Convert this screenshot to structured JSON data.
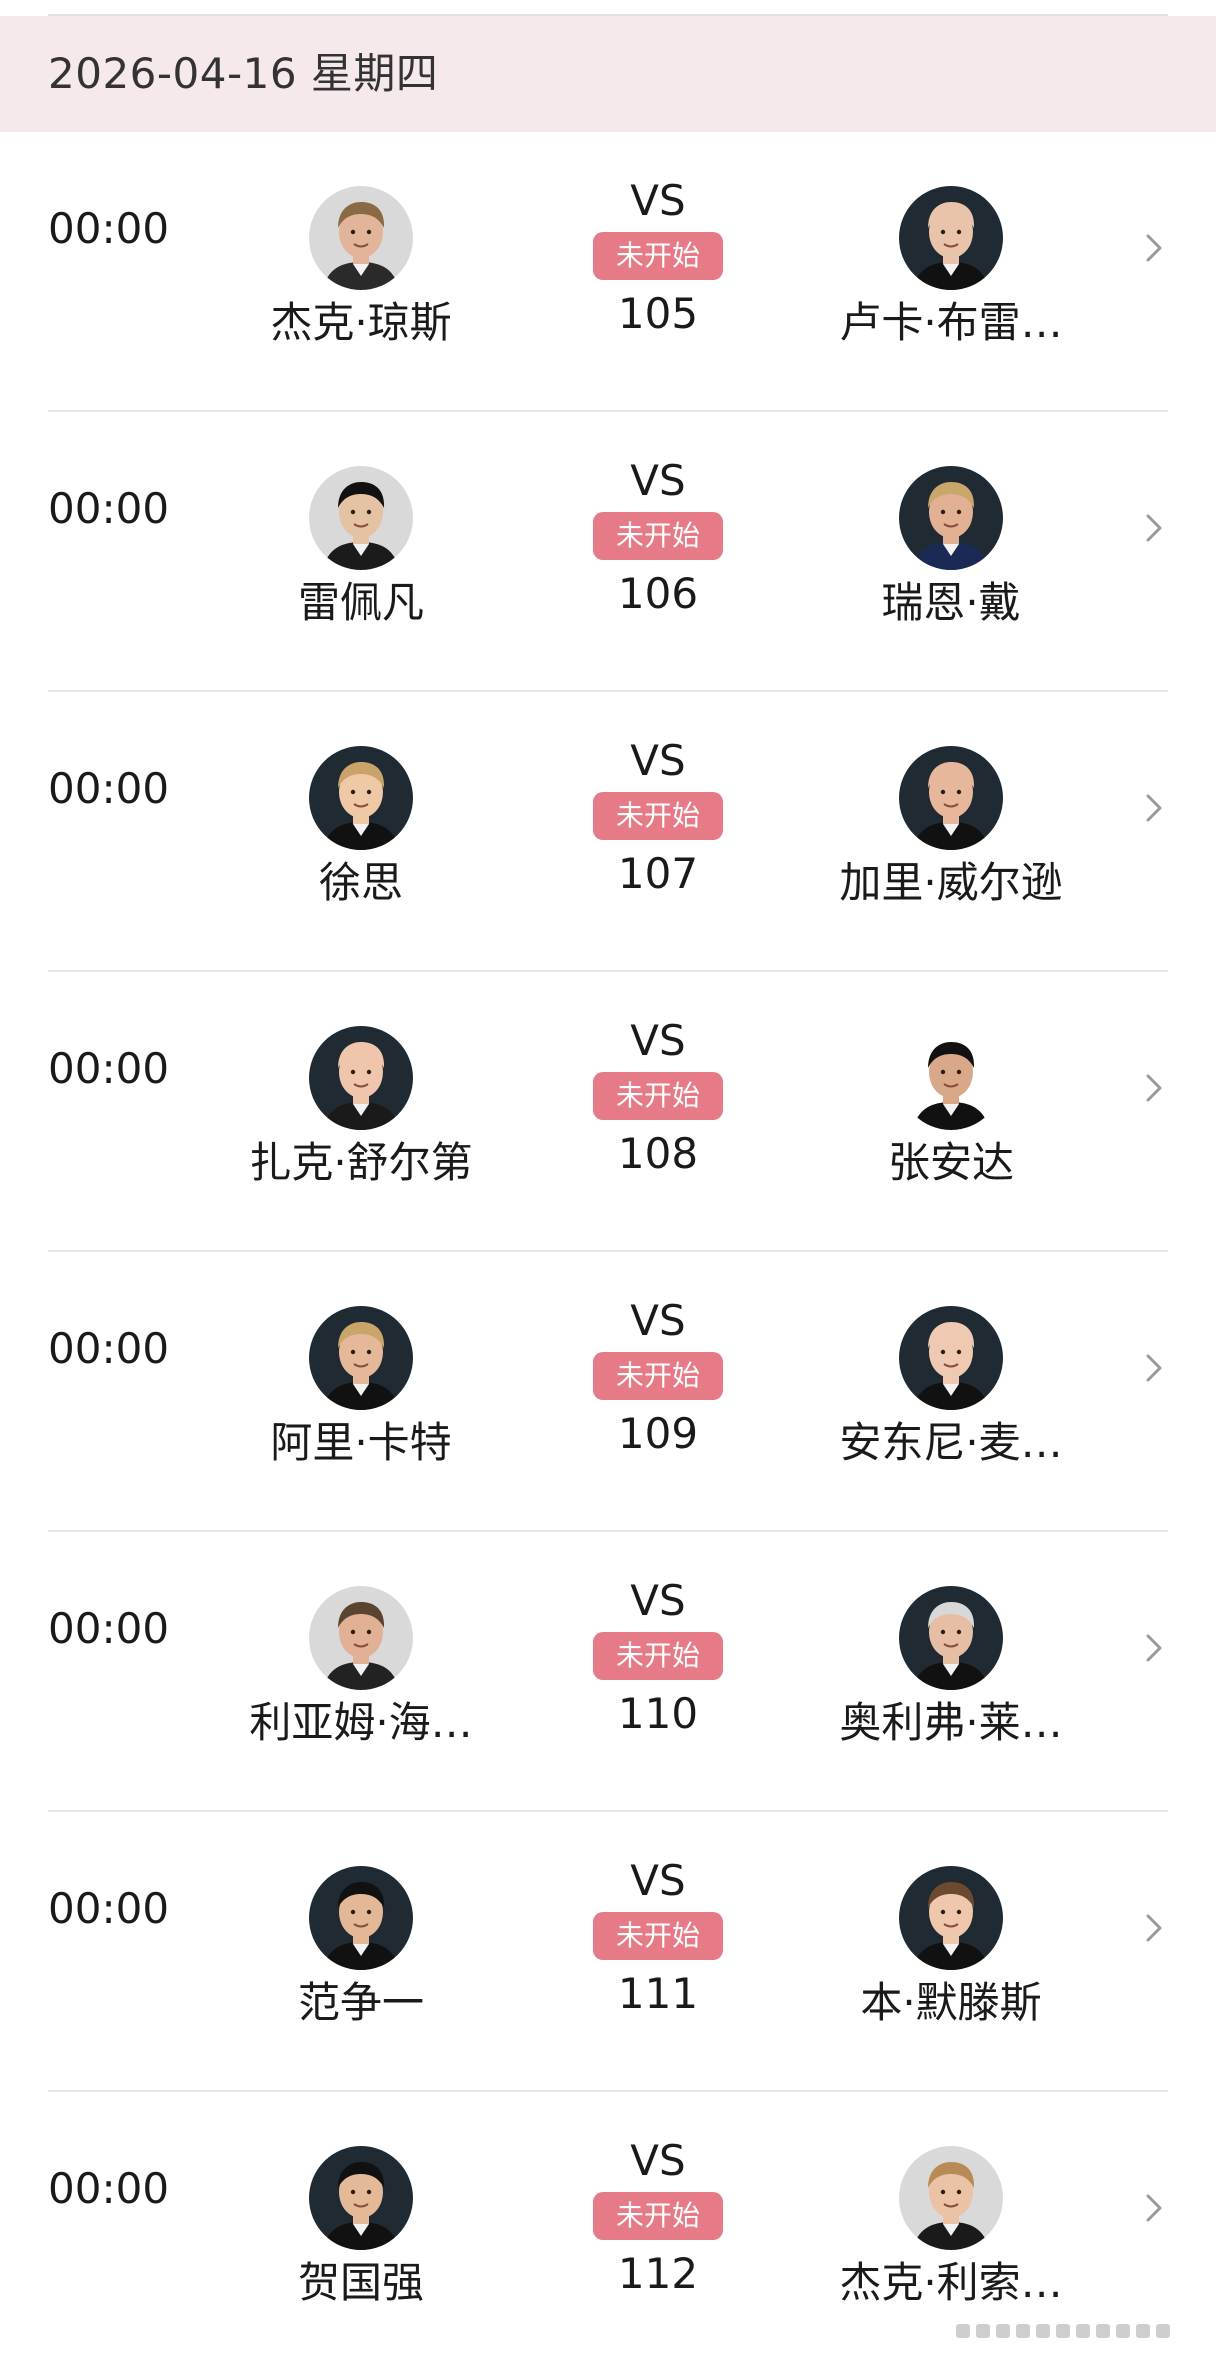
{
  "header": {
    "date": "2026-04-16 星期四",
    "background": "#f6e9ec"
  },
  "colors": {
    "status_badge": "#e67a86",
    "divider": "#e6e6e6"
  },
  "matches": [
    {
      "time": "00:00",
      "vs": "VS",
      "status": "未开始",
      "number": "105",
      "home": {
        "name": "杰克·琼斯",
        "avatar_bg": "#d9d9d9",
        "skin": "#e2b49a",
        "hair": "#8a6a45",
        "shirt": "#2a2a2a"
      },
      "away": {
        "name": "卢卡·布雷…",
        "avatar_bg": "#1f2a33",
        "skin": "#e9c3aa",
        "hair": "#e9c3aa",
        "shirt": "#111111"
      }
    },
    {
      "time": "00:00",
      "vs": "VS",
      "status": "未开始",
      "number": "106",
      "home": {
        "name": "雷佩凡",
        "avatar_bg": "#d9d9d9",
        "skin": "#e6c2a4",
        "hair": "#111111",
        "shirt": "#1b1b1b"
      },
      "away": {
        "name": "瑞恩·戴",
        "avatar_bg": "#1f2a33",
        "skin": "#e2b092",
        "hair": "#c9a76a",
        "shirt": "#1a2a55"
      }
    },
    {
      "time": "00:00",
      "vs": "VS",
      "status": "未开始",
      "number": "107",
      "home": {
        "name": "徐思",
        "avatar_bg": "#1f2a33",
        "skin": "#efc8a6",
        "hair": "#c9a36a",
        "shirt": "#111111"
      },
      "away": {
        "name": "加里·威尔逊",
        "avatar_bg": "#1f2a33",
        "skin": "#e7b79c",
        "hair": "#e7b79c",
        "shirt": "#111111"
      }
    },
    {
      "time": "00:00",
      "vs": "VS",
      "status": "未开始",
      "number": "108",
      "home": {
        "name": "扎克·舒尔第",
        "avatar_bg": "#1f2a33",
        "skin": "#efc6ab",
        "hair": "#efc6ab",
        "shirt": "#1a1a1a"
      },
      "away": {
        "name": "张安达",
        "avatar_bg": "#ffffff",
        "skin": "#d9a888",
        "hair": "#111111",
        "shirt": "#111111"
      }
    },
    {
      "time": "00:00",
      "vs": "VS",
      "status": "未开始",
      "number": "109",
      "home": {
        "name": "阿里·卡特",
        "avatar_bg": "#1f2a33",
        "skin": "#e6b89a",
        "hair": "#c9a56a",
        "shirt": "#111111"
      },
      "away": {
        "name": "安东尼·麦…",
        "avatar_bg": "#1f2a33",
        "skin": "#f0c9b3",
        "hair": "#f0c9b3",
        "shirt": "#111111"
      }
    },
    {
      "time": "00:00",
      "vs": "VS",
      "status": "未开始",
      "number": "110",
      "home": {
        "name": "利亚姆·海…",
        "avatar_bg": "#d9d9d9",
        "skin": "#e2b094",
        "hair": "#5a4330",
        "shirt": "#222222"
      },
      "away": {
        "name": "奥利弗·莱…",
        "avatar_bg": "#1f2a33",
        "skin": "#e6bea3",
        "hair": "#d8d8d8",
        "shirt": "#111111"
      }
    },
    {
      "time": "00:00",
      "vs": "VS",
      "status": "未开始",
      "number": "111",
      "home": {
        "name": "范争一",
        "avatar_bg": "#1f2a33",
        "skin": "#e2b896",
        "hair": "#111111",
        "shirt": "#111111"
      },
      "away": {
        "name": "本·默滕斯",
        "avatar_bg": "#1f2a33",
        "skin": "#efc7ac",
        "hair": "#6b4a30",
        "shirt": "#111111"
      }
    },
    {
      "time": "00:00",
      "vs": "VS",
      "status": "未开始",
      "number": "112",
      "home": {
        "name": "贺国强",
        "avatar_bg": "#1f2a33",
        "skin": "#e4b998",
        "hair": "#111111",
        "shirt": "#111111"
      },
      "away": {
        "name": "杰克·利索…",
        "avatar_bg": "#d9d9d9",
        "skin": "#ecc2a6",
        "hair": "#b88a55",
        "shirt": "#1a1a1a"
      }
    }
  ]
}
